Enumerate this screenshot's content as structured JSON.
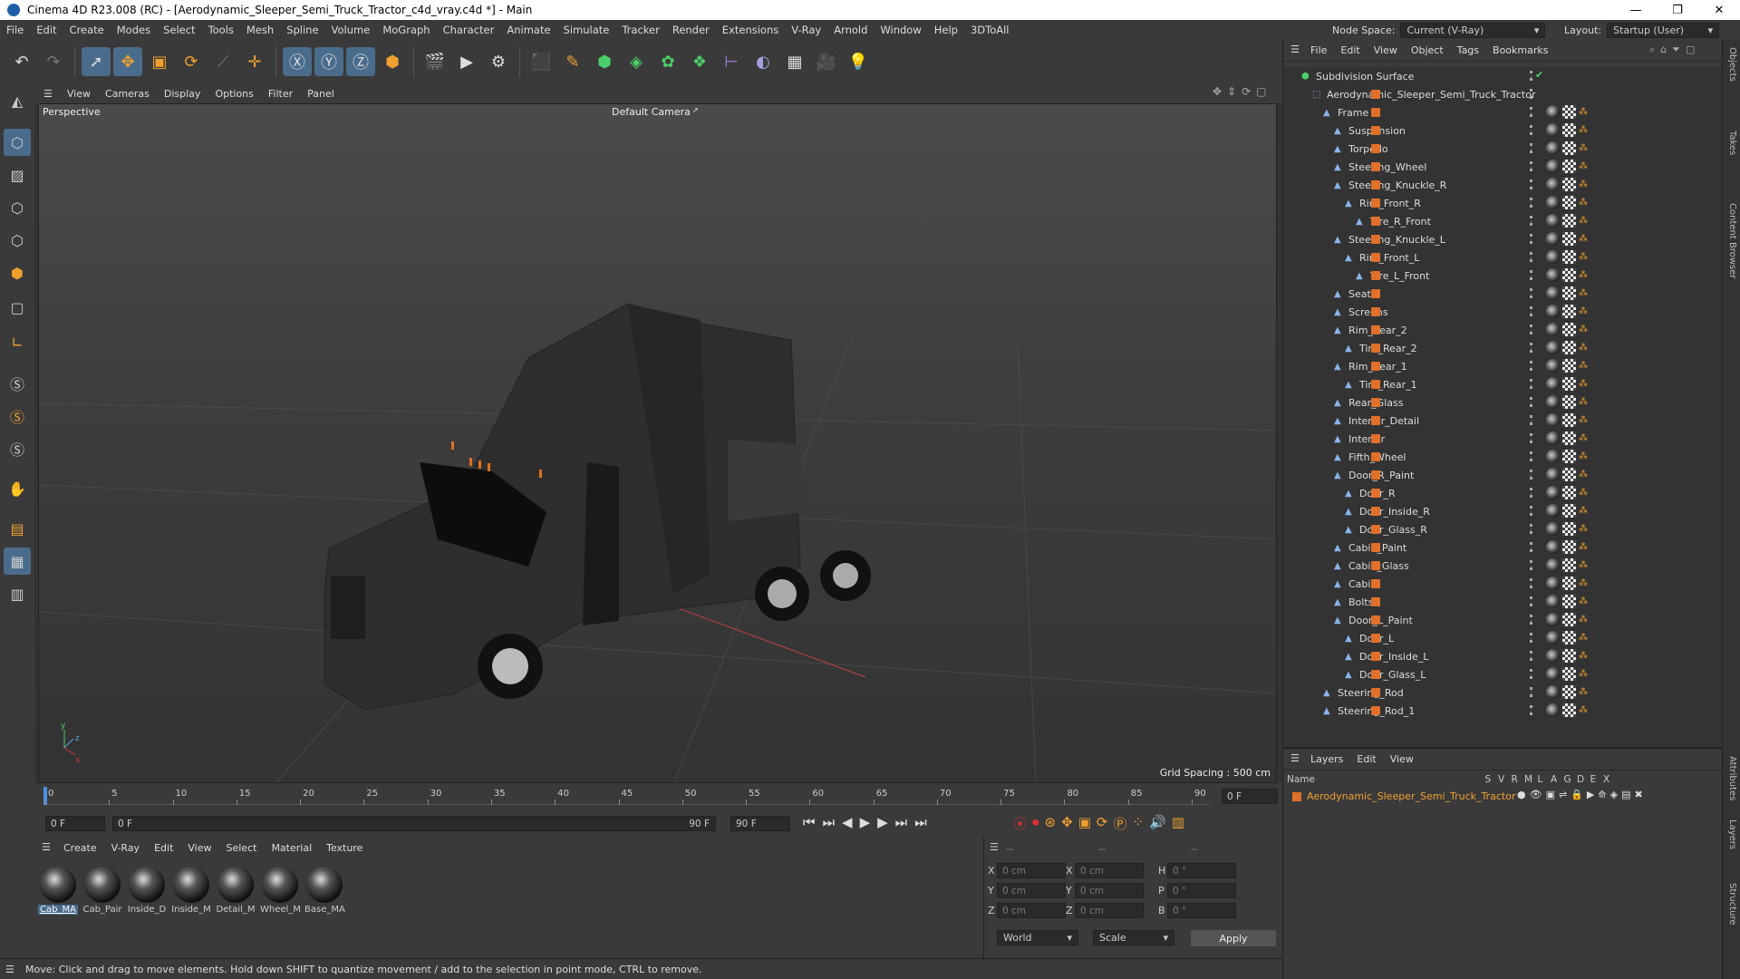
{
  "window": {
    "title": "Cinema 4D R23.008 (RC) - [Aerodynamic_Sleeper_Semi_Truck_Tractor_c4d_vray.c4d *] - Main"
  },
  "menu": [
    "File",
    "Edit",
    "Create",
    "Modes",
    "Select",
    "Tools",
    "Mesh",
    "Spline",
    "Volume",
    "MoGraph",
    "Character",
    "Animate",
    "Simulate",
    "Tracker",
    "Render",
    "Extensions",
    "V-Ray",
    "Arnold",
    "Window",
    "Help",
    "3DToAll"
  ],
  "node_space": {
    "label": "Node Space:",
    "value": "Current (V-Ray)"
  },
  "layout": {
    "label": "Layout:",
    "value": "Startup (User)"
  },
  "viewport_menu": [
    "View",
    "Cameras",
    "Display",
    "Options",
    "Filter",
    "Panel"
  ],
  "viewport": {
    "name": "Perspective",
    "camera": "Default Camera",
    "grid_spacing": "Grid Spacing : 500 cm"
  },
  "timeline": {
    "ticks": [
      "0",
      "5",
      "10",
      "15",
      "20",
      "25",
      "30",
      "35",
      "40",
      "45",
      "50",
      "55",
      "60",
      "65",
      "70",
      "75",
      "80",
      "85",
      "90"
    ],
    "current_frame": "0 F",
    "start_field": "0 F",
    "range_start": "0 F",
    "range_end": "90 F",
    "end_field": "90 F"
  },
  "material_menu": [
    "Create",
    "V-Ray",
    "Edit",
    "View",
    "Select",
    "Material",
    "Texture"
  ],
  "materials": [
    "Cab_MA",
    "Cab_Pair",
    "Inside_D",
    "Inside_M",
    "Detail_M",
    "Wheel_M",
    "Base_MA"
  ],
  "coords": {
    "header": [
      "--",
      "--",
      "--"
    ],
    "rows": [
      {
        "a": "X",
        "av": "0 cm",
        "b": "X",
        "bv": "0 cm",
        "c": "H",
        "cv": "0 °"
      },
      {
        "a": "Y",
        "av": "0 cm",
        "b": "Y",
        "bv": "0 cm",
        "c": "P",
        "cv": "0 °"
      },
      {
        "a": "Z",
        "av": "0 cm",
        "b": "Z",
        "bv": "0 cm",
        "c": "B",
        "cv": "0 °"
      }
    ],
    "world": "World",
    "scale": "Scale",
    "apply": "Apply"
  },
  "status": "Move: Click and drag to move elements. Hold down SHIFT to quantize movement / add to the selection in point mode, CTRL to remove.",
  "object_menu": [
    "File",
    "Edit",
    "View",
    "Object",
    "Tags",
    "Bookmarks"
  ],
  "objects": [
    {
      "name": "Subdivision Surface",
      "lvl": 0
    },
    {
      "name": "Aerodynamic_Sleeper_Semi_Truck_Tractor",
      "lvl": 1
    },
    {
      "name": "Frame",
      "lvl": 2
    },
    {
      "name": "Suspension",
      "lvl": 3
    },
    {
      "name": "Torpedo",
      "lvl": 3
    },
    {
      "name": "Steering_Wheel",
      "lvl": 3
    },
    {
      "name": "Steering_Knuckle_R",
      "lvl": 3
    },
    {
      "name": "Rim_Front_R",
      "lvl": 4
    },
    {
      "name": "Tire_R_Front",
      "lvl": 5
    },
    {
      "name": "Steering_Knuckle_L",
      "lvl": 3
    },
    {
      "name": "Rim_Front_L",
      "lvl": 4
    },
    {
      "name": "Tire_L_Front",
      "lvl": 5
    },
    {
      "name": "Seats",
      "lvl": 3
    },
    {
      "name": "Screens",
      "lvl": 3
    },
    {
      "name": "Rim_Rear_2",
      "lvl": 3
    },
    {
      "name": "Tire_Rear_2",
      "lvl": 4
    },
    {
      "name": "Rim_Rear_1",
      "lvl": 3
    },
    {
      "name": "Tire_Rear_1",
      "lvl": 4
    },
    {
      "name": "Rear_Glass",
      "lvl": 3
    },
    {
      "name": "Interior_Detail",
      "lvl": 3
    },
    {
      "name": "Interior",
      "lvl": 3
    },
    {
      "name": "Fifth_Wheel",
      "lvl": 3
    },
    {
      "name": "Door_R_Paint",
      "lvl": 3
    },
    {
      "name": "Door_R",
      "lvl": 4
    },
    {
      "name": "Door_Inside_R",
      "lvl": 4
    },
    {
      "name": "Door_Glass_R",
      "lvl": 4
    },
    {
      "name": "Cabin_Paint",
      "lvl": 3
    },
    {
      "name": "Cabin_Glass",
      "lvl": 3
    },
    {
      "name": "Cabin",
      "lvl": 3
    },
    {
      "name": "Bolts",
      "lvl": 3
    },
    {
      "name": "Door_L_Paint",
      "lvl": 3
    },
    {
      "name": "Door_L",
      "lvl": 4
    },
    {
      "name": "Door_Inside_L",
      "lvl": 4
    },
    {
      "name": "Door_Glass_L",
      "lvl": 4
    },
    {
      "name": "Steering_Rod",
      "lvl": 2
    },
    {
      "name": "Steering_Rod_1",
      "lvl": 2
    }
  ],
  "layers_menu": [
    "Layers",
    "Edit",
    "View"
  ],
  "layers": {
    "columns": [
      "Name",
      "S",
      "V",
      "R",
      "M",
      "L",
      "A",
      "G",
      "D",
      "E",
      "X"
    ],
    "item": "Aerodynamic_Sleeper_Semi_Truck_Tractor"
  },
  "right_tabs": [
    "Objects",
    "Takes",
    "Content Browser",
    "Attributes",
    "Layers",
    "Structure"
  ],
  "colors": {
    "accent": "#e0702a",
    "selection": "#4a6c8c"
  }
}
